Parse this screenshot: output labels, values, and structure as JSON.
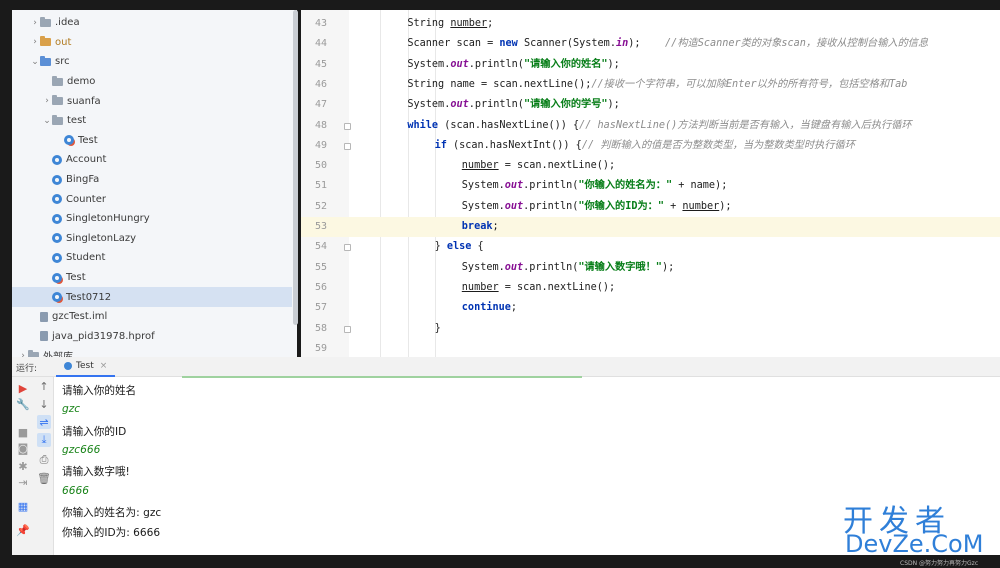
{
  "project_tree": {
    "items": [
      {
        "label": ".idea",
        "kind": "folder",
        "arrow": "›",
        "indent": 1
      },
      {
        "label": "out",
        "kind": "folder-orange",
        "arrow": "›",
        "indent": 1
      },
      {
        "label": "src",
        "kind": "folder-blue",
        "arrow": "⌄",
        "indent": 1
      },
      {
        "label": "demo",
        "kind": "folder",
        "arrow": "",
        "indent": 2
      },
      {
        "label": "suanfa",
        "kind": "folder",
        "arrow": "›",
        "indent": 2
      },
      {
        "label": "test",
        "kind": "folder",
        "arrow": "⌄",
        "indent": 2
      },
      {
        "label": "Test",
        "kind": "class-main",
        "arrow": "",
        "indent": 3
      },
      {
        "label": "Account",
        "kind": "class",
        "arrow": "",
        "indent": 2
      },
      {
        "label": "BingFa",
        "kind": "class",
        "arrow": "",
        "indent": 2
      },
      {
        "label": "Counter",
        "kind": "class",
        "arrow": "",
        "indent": 2
      },
      {
        "label": "SingletonHungry",
        "kind": "class",
        "arrow": "",
        "indent": 2
      },
      {
        "label": "SingletonLazy",
        "kind": "class",
        "arrow": "",
        "indent": 2
      },
      {
        "label": "Student",
        "kind": "class",
        "arrow": "",
        "indent": 2
      },
      {
        "label": "Test",
        "kind": "class-main",
        "arrow": "",
        "indent": 2
      },
      {
        "label": "Test0712",
        "kind": "class-main",
        "arrow": "",
        "indent": 2,
        "selected": true
      },
      {
        "label": "gzcTest.iml",
        "kind": "file",
        "arrow": "",
        "indent": 1
      },
      {
        "label": "java_pid31978.hprof",
        "kind": "file",
        "arrow": "",
        "indent": 1
      },
      {
        "label": "外部库",
        "kind": "folder",
        "arrow": "›",
        "indent": 0
      }
    ]
  },
  "editor": {
    "current_line": 53,
    "lines": [
      {
        "n": "43",
        "indent": 2,
        "html": "String <span class='ul'>number</span>;"
      },
      {
        "n": "44",
        "indent": 2,
        "html": "Scanner scan = <span class='kw'>new</span> Scanner(System.<span class='fld'>in</span>);    <span class='cmt'>//构造Scanner类的对象scan，接收从控制台输入的信息</span>"
      },
      {
        "n": "45",
        "indent": 2,
        "html": "System.<span class='fld'>out</span>.println(<span class='str'>\"请输入你的姓名\"</span>);"
      },
      {
        "n": "46",
        "indent": 2,
        "html": "String name = scan.nextLine();<span class='cmt'>//接收一个字符串，可以加除Enter以外的所有符号，包括空格和Tab</span>"
      },
      {
        "n": "47",
        "indent": 2,
        "html": "System.<span class='fld'>out</span>.println(<span class='str'>\"请输入你的学号\"</span>);"
      },
      {
        "n": "48",
        "indent": 2,
        "html": "<span class='kw'>while</span> (scan.hasNextLine()) {<span class='cmt'>// hasNextLine()方法判断当前是否有输入，当键盘有输入后执行循环</span>"
      },
      {
        "n": "49",
        "indent": 3,
        "html": "<span class='kw'>if</span> (scan.hasNextInt()) {<span class='cmt'>// 判断输入的值是否为整数类型，当为整数类型时执行循环</span>"
      },
      {
        "n": "50",
        "indent": 4,
        "html": "<span class='ul'>number</span> = scan.nextLine();"
      },
      {
        "n": "51",
        "indent": 4,
        "html": "System.<span class='fld'>out</span>.println(<span class='str'>\"你输入的姓名为：\"</span> + name);"
      },
      {
        "n": "52",
        "indent": 4,
        "html": "System.<span class='fld'>out</span>.println(<span class='str'>\"你输入的ID为：\"</span> + <span class='ul'>number</span>);"
      },
      {
        "n": "53",
        "indent": 4,
        "html": "<span class='kw'>break</span>;"
      },
      {
        "n": "54",
        "indent": 3,
        "html": "} <span class='kw'>else</span> {"
      },
      {
        "n": "55",
        "indent": 4,
        "html": "System.<span class='fld'>out</span>.println(<span class='str'>\"请输入数字哦！\"</span>);"
      },
      {
        "n": "56",
        "indent": 4,
        "html": "<span class='ul'>number</span> = scan.nextLine();"
      },
      {
        "n": "57",
        "indent": 4,
        "html": "<span class='kw'>continue</span>;"
      },
      {
        "n": "58",
        "indent": 3,
        "html": "}"
      },
      {
        "n": "59",
        "indent": 2,
        "html": ""
      }
    ]
  },
  "run_panel": {
    "label": "运行:",
    "tab_label": "Test",
    "tab_close": "×",
    "output": [
      {
        "text": "请输入你的姓名",
        "input": false
      },
      {
        "text": "gzc",
        "input": true
      },
      {
        "text": "请输入你的ID",
        "input": false
      },
      {
        "text": "gzc666",
        "input": true
      },
      {
        "text": "请输入数字哦!",
        "input": false
      },
      {
        "text": "6666",
        "input": true
      },
      {
        "text": "你输入的姓名为: gzc",
        "input": false
      },
      {
        "text": "你输入的ID为: 6666",
        "input": false
      }
    ],
    "tools_left": [
      {
        "icon": "run-icon",
        "glyph": "▶",
        "color": "#e0443a"
      },
      {
        "icon": "wrench-icon",
        "glyph": "🔧",
        "color": "#3574f0"
      },
      {
        "icon": "stop-icon",
        "glyph": "■",
        "color": "#9a9a9a"
      },
      {
        "icon": "camera-icon",
        "glyph": "◙",
        "color": "#9a9a9a"
      },
      {
        "icon": "bug-icon",
        "glyph": "✱",
        "color": "#9a9a9a"
      },
      {
        "icon": "exit-icon",
        "glyph": "⇥",
        "color": "#9a9a9a"
      },
      {
        "icon": "layout-icon",
        "glyph": "▦",
        "color": "#3574f0"
      },
      {
        "icon": "pin-icon",
        "glyph": "📌",
        "color": "#3574f0"
      }
    ],
    "tools_right": [
      {
        "icon": "up-arrow-icon",
        "glyph": "↑",
        "active": false
      },
      {
        "icon": "down-arrow-icon",
        "glyph": "↓",
        "active": false
      },
      {
        "icon": "soft-wrap-icon",
        "glyph": "⇌",
        "active": true
      },
      {
        "icon": "scroll-end-icon",
        "glyph": "⤓",
        "active": true
      },
      {
        "icon": "print-icon",
        "glyph": "⎙",
        "active": false
      },
      {
        "icon": "trash-icon",
        "glyph": "🗑",
        "active": false
      }
    ]
  },
  "watermark": {
    "cn": "开发者",
    "en": "DevZe.CoM",
    "csdn": "CSDN @努力努力再努力Gzc"
  }
}
